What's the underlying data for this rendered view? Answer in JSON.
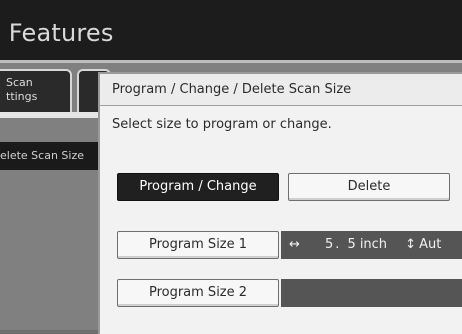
{
  "header": {
    "title": "e Features"
  },
  "tabs": {
    "scan_settings_label": "Scan\nttings",
    "delete_scan_size_label": "elete Scan Size"
  },
  "dialog": {
    "title": "Program / Change / Delete Scan Size",
    "instruction": "Select size to program or change.",
    "program_change_label": "Program / Change",
    "delete_label": "Delete",
    "sizes": [
      {
        "label": "Program Size 1",
        "width_value": "5. 5",
        "unit": "inch",
        "height_value": "Aut"
      },
      {
        "label": "Program Size 2"
      }
    ]
  },
  "icons": {
    "horizontal_arrow": "↔",
    "vertical_arrow": "↕"
  },
  "colors": {
    "title_bar": "#1c1c1c",
    "selected_button": "#202020",
    "size_display": "#555555"
  }
}
